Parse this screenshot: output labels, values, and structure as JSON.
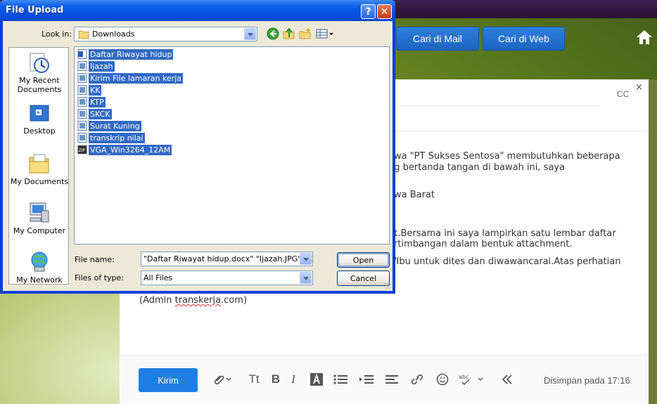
{
  "web": {
    "search_mail": "Cari di Mail",
    "search_web": "Cari di Web",
    "cc": "CC",
    "close": "×",
    "body_lines": [
      "awa \"PT Sukses Sentosa\" membutuhkan beberapa",
      "ng bertanda tangan di bawah ini, saya",
      "awa Barat",
      "ut.Bersama ini saya lampirkan satu lembar daftar",
      "ertimbangan dalam bentuk attachment.",
      "c/Ibu untuk dites dan diwawancarai.Atas perhatian"
    ],
    "signature_prefix": "(Admin ",
    "signature_link": "transkerja",
    "signature_suffix": ".com)",
    "send": "Kirim",
    "saved": "Disimpan pada 17:16",
    "tools": {
      "text_size": "Tt",
      "bold": "B",
      "italic": "I"
    }
  },
  "dialog": {
    "title": "File Upload",
    "help": "?",
    "close": "✕",
    "look_in_label": "Look in:",
    "look_in_value": "Downloads",
    "places": [
      "My Recent\nDocuments",
      "Desktop",
      "My Documents",
      "My Computer",
      "My Network"
    ],
    "files": [
      "Daftar Riwayat hidup",
      "Ijazah",
      "Kirim File lamaran kerja",
      "KK",
      "KTP",
      "SKCK",
      "Surat Kuning",
      "transkrip nilai",
      "VGA_Win3264_12AM"
    ],
    "file_name_label": "File name:",
    "file_name_value": "\"Daftar Riwayat hidup.docx\" \"Ijazah.JPG\" \"Kiri",
    "file_type_label": "Files of type:",
    "file_type_value": "All Files",
    "open": "Open",
    "cancel": "Cancel"
  }
}
